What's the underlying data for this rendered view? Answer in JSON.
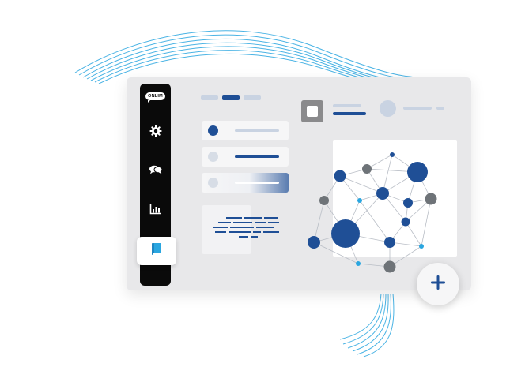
{
  "colors": {
    "accent": "#1f4f96",
    "accent_light": "#2aa6e0",
    "node_gray": "#6e7378",
    "panel_bg": "#e8e8ea",
    "sidebar_bg": "#0a0a0a"
  },
  "sidebar": {
    "logo_text": "ONLIM",
    "items": [
      {
        "icon": "logo-chat-icon",
        "active": false
      },
      {
        "icon": "gear-icon",
        "active": false
      },
      {
        "icon": "chat-bubbles-icon",
        "active": false
      },
      {
        "icon": "bar-chart-icon",
        "active": false
      },
      {
        "icon": "book-icon",
        "active": true
      }
    ]
  },
  "tabs": {
    "count": 3,
    "active_index": 1
  },
  "list": {
    "rows": 3,
    "active_index": 2
  },
  "add_button": {
    "icon": "plus-icon"
  }
}
